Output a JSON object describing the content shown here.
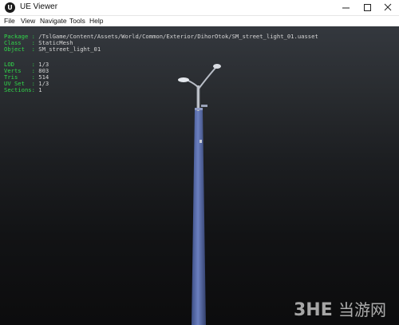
{
  "window": {
    "title": "UE Viewer",
    "icon_text": "U",
    "controls": [
      "minimize-icon",
      "maximize-icon",
      "close-icon"
    ]
  },
  "menu": [
    "File",
    "View",
    "Navigate",
    "Tools",
    "Help"
  ],
  "asset_info": {
    "package_label": "Package",
    "package_value": "/TslGame/Content/Assets/World/Common/Exterior/DihorOtok/SM_street_light_01.uasset",
    "class_label": "Class",
    "class_value": "StaticMesh",
    "object_label": "Object",
    "object_value": "SM_street_light_01"
  },
  "mesh_info": {
    "lod_label": "LOD",
    "lod_value": "1/3",
    "verts_label": "Verts",
    "verts_value": "803",
    "tris_label": "Tris",
    "tris_value": "514",
    "uvset_label": "UV Set",
    "uvset_value": "1/3",
    "sections_label": "Sections",
    "sections_value": "1"
  },
  "watermark": {
    "logo": "3HE",
    "text": "当游网"
  },
  "colors": {
    "label_green": "#31d84a",
    "value_text": "#d6d6d6",
    "pole_blue": "#4a5f9a"
  }
}
